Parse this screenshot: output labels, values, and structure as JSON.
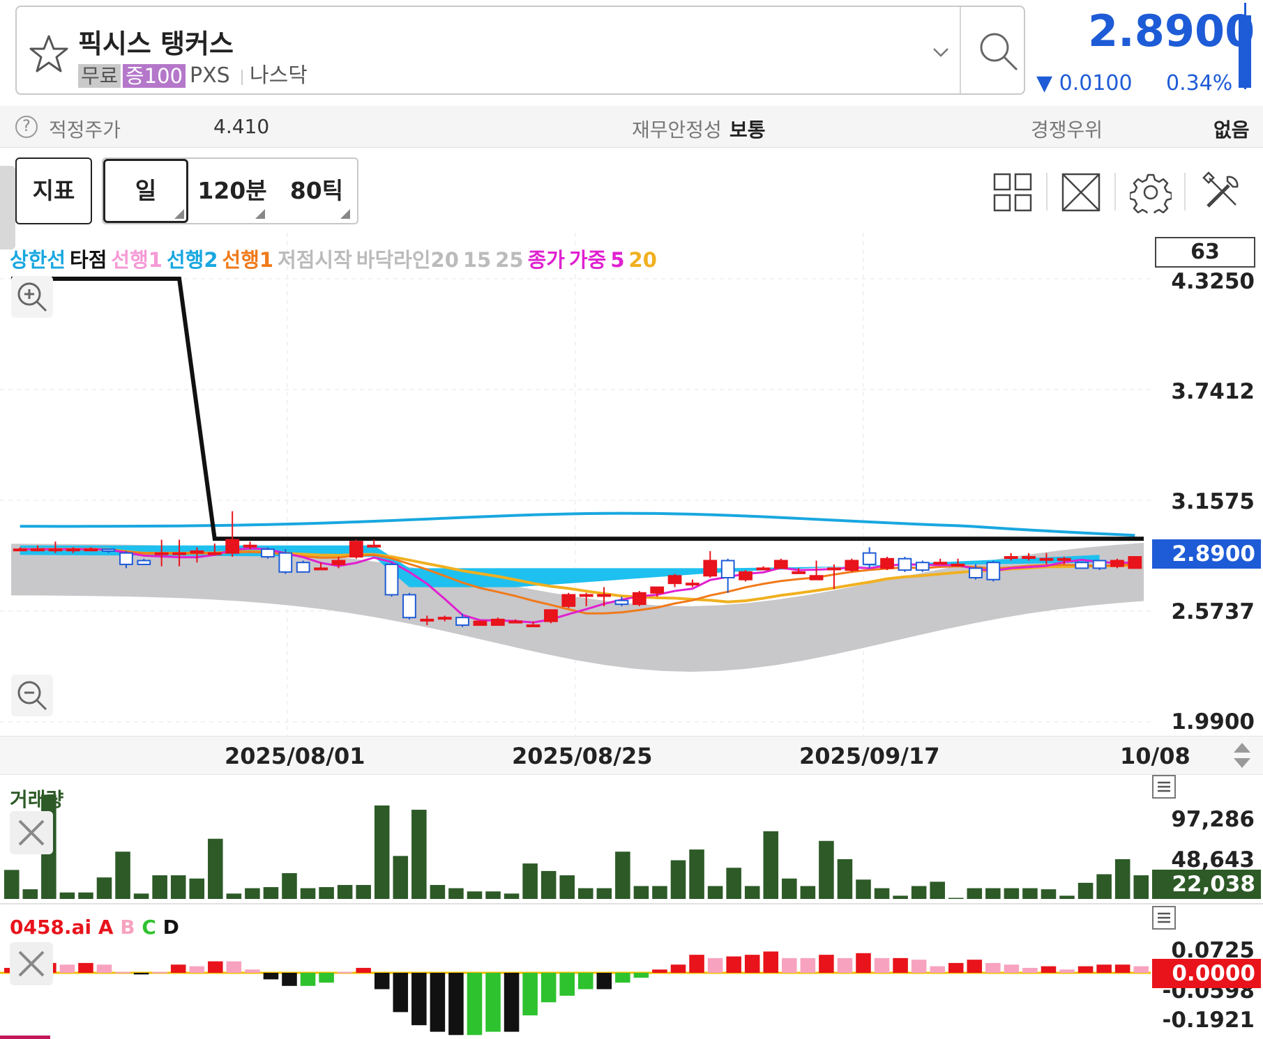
{
  "header": {
    "stock_name": "픽시스 탱커스",
    "tag_free": "무료",
    "tag_margin": "증100",
    "ticker": "PXS",
    "exchange": "나스닥",
    "price": "2.8900",
    "change": "▼ 0.0100",
    "change_pct": "0.34%",
    "price_color": "#1e5bd6"
  },
  "info": {
    "fair_price_label": "적정주가",
    "fair_price_value": "4.410",
    "stability_label": "재무안정성",
    "stability_value": "보통",
    "rank_label": "경쟁우위",
    "rank_value": "없음"
  },
  "toolbar": {
    "indicator": "지표",
    "day": "일",
    "min120": "120분",
    "tick80": "80틱"
  },
  "legend": [
    {
      "text": "상한선",
      "color": "#19a7e0"
    },
    {
      "text": "타점",
      "color": "#111111"
    },
    {
      "text": "선행1",
      "color": "#f59ad6"
    },
    {
      "text": "선행2",
      "color": "#19a7e0"
    },
    {
      "text": "선행1",
      "color": "#f07a1a"
    },
    {
      "text": "저점시작",
      "color": "#bbbbbb"
    },
    {
      "text": "바닥라인20",
      "color": "#bbbbbb"
    },
    {
      "text": "15",
      "color": "#bbbbbb"
    },
    {
      "text": "25",
      "color": "#bbbbbb"
    },
    {
      "text": "종가",
      "color": "#e020d0"
    },
    {
      "text": "가중",
      "color": "#e020d0"
    },
    {
      "text": "5",
      "color": "#e020d0"
    },
    {
      "text": "20",
      "color": "#f0b020"
    }
  ],
  "price_chart": {
    "period": "63",
    "y_ticks": [
      "4.3250",
      "3.7412",
      "3.1575",
      "2.5737",
      "1.9900"
    ],
    "current": "2.8900",
    "dates": [
      "2025/08/01",
      "2025/08/25",
      "2025/09/17",
      "10/08"
    ],
    "candles": [
      {
        "o": 2.9,
        "c": 2.9,
        "h": 2.91,
        "l": 2.89
      },
      {
        "o": 2.9,
        "c": 2.9,
        "h": 2.92,
        "l": 2.89
      },
      {
        "o": 2.9,
        "c": 2.9,
        "h": 2.94,
        "l": 2.88
      },
      {
        "o": 2.9,
        "c": 2.9,
        "h": 2.91,
        "l": 2.88
      },
      {
        "o": 2.9,
        "c": 2.9,
        "h": 2.91,
        "l": 2.89
      },
      {
        "o": 2.9,
        "c": 2.89,
        "h": 2.9,
        "l": 2.88
      },
      {
        "o": 2.88,
        "c": 2.82,
        "h": 2.89,
        "l": 2.8
      },
      {
        "o": 2.84,
        "c": 2.82,
        "h": 2.85,
        "l": 2.82
      },
      {
        "o": 2.88,
        "c": 2.88,
        "h": 2.95,
        "l": 2.81
      },
      {
        "o": 2.88,
        "c": 2.88,
        "h": 2.95,
        "l": 2.81
      },
      {
        "o": 2.88,
        "c": 2.89,
        "h": 2.91,
        "l": 2.83
      },
      {
        "o": 2.88,
        "c": 2.88,
        "h": 2.93,
        "l": 2.88
      },
      {
        "o": 2.88,
        "c": 2.95,
        "h": 3.1,
        "l": 2.86
      },
      {
        "o": 2.92,
        "c": 2.92,
        "h": 2.94,
        "l": 2.9
      },
      {
        "o": 2.9,
        "c": 2.86,
        "h": 2.91,
        "l": 2.85
      },
      {
        "o": 2.88,
        "c": 2.78,
        "h": 2.9,
        "l": 2.77
      },
      {
        "o": 2.83,
        "c": 2.78,
        "h": 2.84,
        "l": 2.78
      },
      {
        "o": 2.8,
        "c": 2.8,
        "h": 2.83,
        "l": 2.8
      },
      {
        "o": 2.82,
        "c": 2.84,
        "h": 2.86,
        "l": 2.8
      },
      {
        "o": 2.86,
        "c": 2.94,
        "h": 2.95,
        "l": 2.85
      },
      {
        "o": 2.92,
        "c": 2.92,
        "h": 2.95,
        "l": 2.91
      },
      {
        "o": 2.82,
        "c": 2.66,
        "h": 2.83,
        "l": 2.65
      },
      {
        "o": 2.66,
        "c": 2.54,
        "h": 2.67,
        "l": 2.53
      },
      {
        "o": 2.53,
        "c": 2.53,
        "h": 2.55,
        "l": 2.5
      },
      {
        "o": 2.54,
        "c": 2.54,
        "h": 2.55,
        "l": 2.52
      },
      {
        "o": 2.54,
        "c": 2.5,
        "h": 2.56,
        "l": 2.49
      },
      {
        "o": 2.5,
        "c": 2.52,
        "h": 2.52,
        "l": 2.5
      },
      {
        "o": 2.5,
        "c": 2.53,
        "h": 2.54,
        "l": 2.5
      },
      {
        "o": 2.52,
        "c": 2.52,
        "h": 2.53,
        "l": 2.51
      },
      {
        "o": 2.5,
        "c": 2.5,
        "h": 2.52,
        "l": 2.49
      },
      {
        "o": 2.52,
        "c": 2.58,
        "h": 2.58,
        "l": 2.51
      },
      {
        "o": 2.6,
        "c": 2.66,
        "h": 2.67,
        "l": 2.59
      },
      {
        "o": 2.66,
        "c": 2.66,
        "h": 2.67,
        "l": 2.6
      },
      {
        "o": 2.66,
        "c": 2.66,
        "h": 2.7,
        "l": 2.6
      },
      {
        "o": 2.63,
        "c": 2.61,
        "h": 2.65,
        "l": 2.6
      },
      {
        "o": 2.61,
        "c": 2.67,
        "h": 2.68,
        "l": 2.6
      },
      {
        "o": 2.67,
        "c": 2.7,
        "h": 2.7,
        "l": 2.65
      },
      {
        "o": 2.72,
        "c": 2.76,
        "h": 2.77,
        "l": 2.7
      },
      {
        "o": 2.72,
        "c": 2.72,
        "h": 2.74,
        "l": 2.7
      },
      {
        "o": 2.76,
        "c": 2.84,
        "h": 2.89,
        "l": 2.75
      },
      {
        "o": 2.84,
        "c": 2.75,
        "h": 2.85,
        "l": 2.67
      },
      {
        "o": 2.74,
        "c": 2.78,
        "h": 2.79,
        "l": 2.73
      },
      {
        "o": 2.8,
        "c": 2.8,
        "h": 2.81,
        "l": 2.79
      },
      {
        "o": 2.8,
        "c": 2.84,
        "h": 2.85,
        "l": 2.8
      },
      {
        "o": 2.78,
        "c": 2.78,
        "h": 2.8,
        "l": 2.77
      },
      {
        "o": 2.74,
        "c": 2.76,
        "h": 2.84,
        "l": 2.74
      },
      {
        "o": 2.8,
        "c": 2.8,
        "h": 2.82,
        "l": 2.69
      },
      {
        "o": 2.79,
        "c": 2.84,
        "h": 2.85,
        "l": 2.78
      },
      {
        "o": 2.88,
        "c": 2.82,
        "h": 2.91,
        "l": 2.8
      },
      {
        "o": 2.8,
        "c": 2.85,
        "h": 2.86,
        "l": 2.79
      },
      {
        "o": 2.85,
        "c": 2.79,
        "h": 2.86,
        "l": 2.78
      },
      {
        "o": 2.83,
        "c": 2.79,
        "h": 2.84,
        "l": 2.78
      },
      {
        "o": 2.83,
        "c": 2.83,
        "h": 2.85,
        "l": 2.82
      },
      {
        "o": 2.82,
        "c": 2.82,
        "h": 2.85,
        "l": 2.81
      },
      {
        "o": 2.8,
        "c": 2.75,
        "h": 2.82,
        "l": 2.74
      },
      {
        "o": 2.83,
        "c": 2.74,
        "h": 2.84,
        "l": 2.73
      },
      {
        "o": 2.86,
        "c": 2.86,
        "h": 2.88,
        "l": 2.84
      },
      {
        "o": 2.86,
        "c": 2.86,
        "h": 2.88,
        "l": 2.84
      },
      {
        "o": 2.85,
        "c": 2.85,
        "h": 2.88,
        "l": 2.82
      },
      {
        "o": 2.85,
        "c": 2.85,
        "h": 2.86,
        "l": 2.82
      },
      {
        "o": 2.83,
        "c": 2.8,
        "h": 2.83,
        "l": 2.8
      },
      {
        "o": 2.84,
        "c": 2.8,
        "h": 2.84,
        "l": 2.79
      },
      {
        "o": 2.81,
        "c": 2.84,
        "h": 2.85,
        "l": 2.8
      },
      {
        "o": 2.8,
        "c": 2.86,
        "h": 2.86,
        "l": 2.8
      }
    ]
  },
  "volume": {
    "title": "거래량",
    "y_ticks": [
      "97,286",
      "48,643"
    ],
    "current": "22,038",
    "values": [
      27000,
      9000,
      97000,
      6000,
      6000,
      20000,
      44000,
      5000,
      22000,
      22000,
      19000,
      56000,
      5000,
      10000,
      11000,
      24000,
      10000,
      11000,
      13000,
      13000,
      87000,
      40000,
      83000,
      13000,
      10000,
      7000,
      7000,
      5000,
      33000,
      26000,
      22000,
      10000,
      10000,
      44000,
      12000,
      12000,
      36000,
      46000,
      12000,
      29000,
      12000,
      63000,
      19000,
      12000,
      54000,
      37000,
      18000,
      10000,
      3000,
      12000,
      16000,
      1000,
      10000,
      10000,
      10000,
      10000,
      9000,
      3000,
      15000,
      23000,
      37000,
      22000
    ]
  },
  "ai": {
    "title": "0458.ai",
    "labels": [
      {
        "text": "A",
        "color": "#e8131b"
      },
      {
        "text": "B",
        "color": "#f7a3c0"
      },
      {
        "text": "C",
        "color": "#2ec22e"
      },
      {
        "text": "D",
        "color": "#111111"
      }
    ],
    "y_ticks": [
      "0.0725",
      "-0.0598",
      "-0.1921"
    ],
    "current": "0.0000",
    "bars": [
      {
        "v": 0.015,
        "c": "A"
      },
      {
        "v": 0.025,
        "c": "A"
      },
      {
        "v": 0.03,
        "c": "A"
      },
      {
        "v": 0.025,
        "c": "B"
      },
      {
        "v": 0.03,
        "c": "A"
      },
      {
        "v": 0.025,
        "c": "B"
      },
      {
        "v": 0.003,
        "c": "B"
      },
      {
        "v": -0.005,
        "c": "D"
      },
      {
        "v": 0.003,
        "c": "B"
      },
      {
        "v": 0.025,
        "c": "A"
      },
      {
        "v": 0.02,
        "c": "B"
      },
      {
        "v": 0.035,
        "c": "A"
      },
      {
        "v": 0.035,
        "c": "B"
      },
      {
        "v": 0.01,
        "c": "B"
      },
      {
        "v": -0.02,
        "c": "D"
      },
      {
        "v": -0.04,
        "c": "D"
      },
      {
        "v": -0.04,
        "c": "C"
      },
      {
        "v": -0.03,
        "c": "C"
      },
      {
        "v": 0.003,
        "c": "B"
      },
      {
        "v": 0.015,
        "c": "A"
      },
      {
        "v": -0.05,
        "c": "D"
      },
      {
        "v": -0.12,
        "c": "D"
      },
      {
        "v": -0.16,
        "c": "D"
      },
      {
        "v": -0.18,
        "c": "D"
      },
      {
        "v": -0.19,
        "c": "D"
      },
      {
        "v": -0.19,
        "c": "C"
      },
      {
        "v": -0.18,
        "c": "C"
      },
      {
        "v": -0.18,
        "c": "D"
      },
      {
        "v": -0.13,
        "c": "C"
      },
      {
        "v": -0.09,
        "c": "C"
      },
      {
        "v": -0.07,
        "c": "C"
      },
      {
        "v": -0.05,
        "c": "C"
      },
      {
        "v": -0.05,
        "c": "D"
      },
      {
        "v": -0.03,
        "c": "C"
      },
      {
        "v": -0.015,
        "c": "C"
      },
      {
        "v": 0.01,
        "c": "A"
      },
      {
        "v": 0.025,
        "c": "A"
      },
      {
        "v": 0.055,
        "c": "A"
      },
      {
        "v": 0.045,
        "c": "B"
      },
      {
        "v": 0.05,
        "c": "A"
      },
      {
        "v": 0.055,
        "c": "A"
      },
      {
        "v": 0.065,
        "c": "A"
      },
      {
        "v": 0.045,
        "c": "B"
      },
      {
        "v": 0.045,
        "c": "B"
      },
      {
        "v": 0.055,
        "c": "A"
      },
      {
        "v": 0.045,
        "c": "B"
      },
      {
        "v": 0.06,
        "c": "A"
      },
      {
        "v": 0.045,
        "c": "B"
      },
      {
        "v": 0.045,
        "c": "A"
      },
      {
        "v": 0.04,
        "c": "B"
      },
      {
        "v": 0.02,
        "c": "B"
      },
      {
        "v": 0.03,
        "c": "A"
      },
      {
        "v": 0.04,
        "c": "A"
      },
      {
        "v": 0.03,
        "c": "B"
      },
      {
        "v": 0.025,
        "c": "B"
      },
      {
        "v": 0.015,
        "c": "B"
      },
      {
        "v": 0.02,
        "c": "A"
      },
      {
        "v": 0.01,
        "c": "B"
      },
      {
        "v": 0.02,
        "c": "A"
      },
      {
        "v": 0.025,
        "c": "A"
      },
      {
        "v": 0.025,
        "c": "A"
      },
      {
        "v": 0.02,
        "c": "B"
      }
    ]
  }
}
